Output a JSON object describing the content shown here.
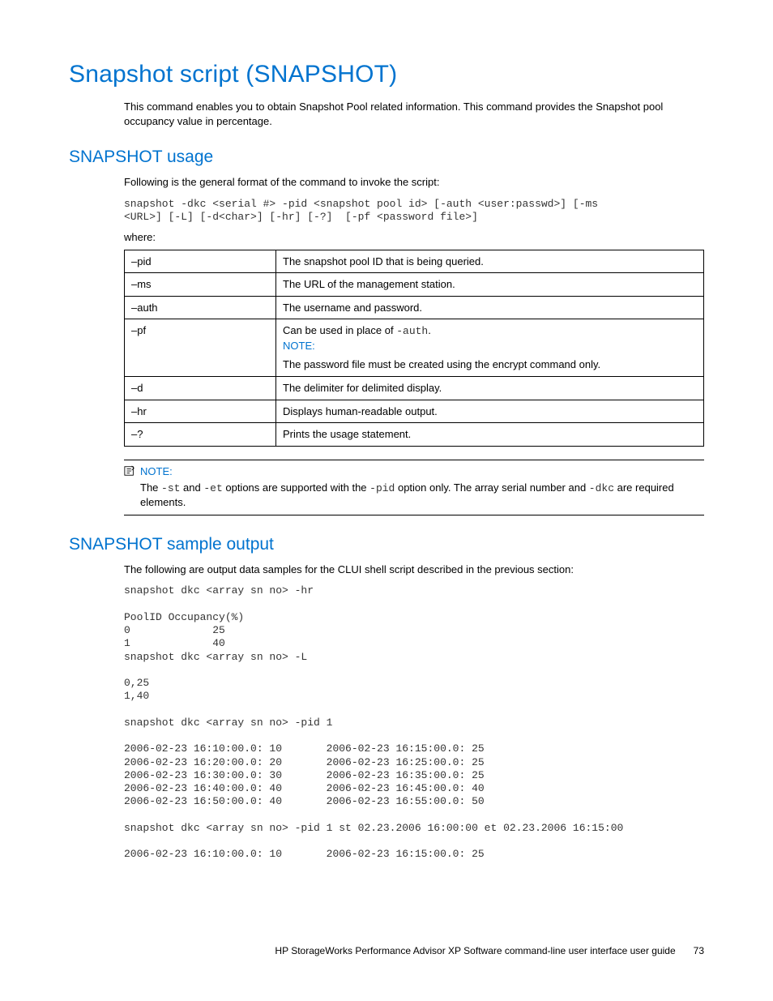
{
  "h1": "Snapshot script (SNAPSHOT)",
  "intro": "This command enables you to obtain Snapshot Pool related information. This command provides the Snapshot pool occupancy value in percentage.",
  "usage": {
    "heading": "SNAPSHOT usage",
    "lead": "Following is the general format of the command to invoke the script:",
    "cmd": "snapshot -dkc <serial #> -pid <snapshot pool id> [-auth <user:passwd>] [-ms\n<URL>] [-L] [-d<char>] [-hr] [-?]  [-pf <password file>]",
    "where": "where:",
    "table": [
      {
        "flag": "–pid",
        "desc": "The snapshot pool ID that is being queried."
      },
      {
        "flag": "–ms",
        "desc": "The URL of the management station."
      },
      {
        "flag": "–auth",
        "desc": "The username and password."
      },
      {
        "flag": "–pf",
        "pf_pre": "Can be used in place of ",
        "pf_mono": "-auth",
        "pf_post": ".",
        "pf_note_label": "NOTE:",
        "pf_note_text": "The password file must be created using the encrypt command only."
      },
      {
        "flag": "–d",
        "desc": "The delimiter for delimited display."
      },
      {
        "flag": "–hr",
        "desc": "Displays human-readable output."
      },
      {
        "flag": "–?",
        "desc": "Prints the usage statement."
      }
    ]
  },
  "note": {
    "label": "NOTE:",
    "pre1": "The ",
    "m1": "-st",
    "mid1": " and ",
    "m2": "-et",
    "mid2": " options are supported with the ",
    "m3": "-pid",
    "mid3": " option only. The array serial number and ",
    "m4": "-dkc",
    "post": " are required elements."
  },
  "sample": {
    "heading": "SNAPSHOT sample output",
    "lead": "The following are output data samples for the CLUI shell script described in the previous section:",
    "output": "snapshot dkc <array sn no> -hr\n\nPoolID Occupancy(%)\n0             25\n1             40\nsnapshot dkc <array sn no> -L\n\n0,25\n1,40\n\nsnapshot dkc <array sn no> -pid 1\n\n2006-02-23 16:10:00.0: 10       2006-02-23 16:15:00.0: 25\n2006-02-23 16:20:00.0: 20       2006-02-23 16:25:00.0: 25\n2006-02-23 16:30:00.0: 30       2006-02-23 16:35:00.0: 25\n2006-02-23 16:40:00.0: 40       2006-02-23 16:45:00.0: 40\n2006-02-23 16:50:00.0: 40       2006-02-23 16:55:00.0: 50\n\nsnapshot dkc <array sn no> -pid 1 st 02.23.2006 16:00:00 et 02.23.2006 16:15:00\n\n2006-02-23 16:10:00.0: 10       2006-02-23 16:15:00.0: 25"
  },
  "footer": {
    "title": "HP StorageWorks Performance Advisor XP Software command-line user interface user guide",
    "page": "73"
  }
}
